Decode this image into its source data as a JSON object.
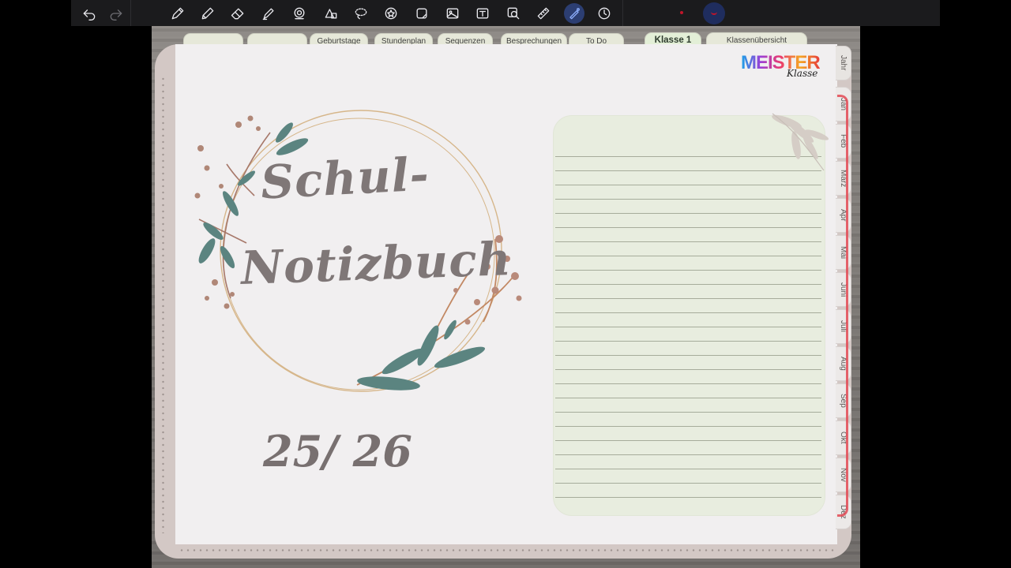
{
  "toolbar": {
    "tools": [
      {
        "name": "undo-icon",
        "label": "Undo"
      },
      {
        "name": "redo-icon",
        "label": "Redo"
      },
      {
        "name": "pen-icon",
        "label": "Pen"
      },
      {
        "name": "pencil-icon",
        "label": "Pencil"
      },
      {
        "name": "eraser-icon",
        "label": "Eraser"
      },
      {
        "name": "highlighter-icon",
        "label": "Highlighter"
      },
      {
        "name": "shapes-icon",
        "label": "Shapes"
      },
      {
        "name": "elements-icon",
        "label": "Elements"
      },
      {
        "name": "lasso-icon",
        "label": "Lasso"
      },
      {
        "name": "star-icon",
        "label": "Favorites"
      },
      {
        "name": "sticker-icon",
        "label": "Stickers"
      },
      {
        "name": "image-icon",
        "label": "Image"
      },
      {
        "name": "text-icon",
        "label": "Text"
      },
      {
        "name": "zoom-icon",
        "label": "Zoom"
      },
      {
        "name": "ruler-icon",
        "label": "Ruler"
      },
      {
        "name": "laser-icon",
        "label": "Laser"
      },
      {
        "name": "clock-icon",
        "label": "Timer"
      }
    ],
    "colors": {
      "background": "#1b1b1d",
      "icon": "#e9e9ee",
      "active": "#2c3e72",
      "record": "#c0152a"
    }
  },
  "planner": {
    "top_tabs": [
      {
        "label": ""
      },
      {
        "label": ""
      },
      {
        "label": "Geburtstage"
      },
      {
        "label": "Stundenplan"
      },
      {
        "label": "Sequenzen"
      },
      {
        "label": "Besprechungen"
      },
      {
        "label": "To Do"
      },
      {
        "label": "Klasse 1",
        "selected": true
      },
      {
        "label": "Klassenübersicht"
      }
    ],
    "month_tabs": [
      "Jahr",
      "Jan",
      "Feb",
      "März",
      "Apr",
      "Mai",
      "Juni",
      "Juli",
      "Aug",
      "Sep",
      "Okt",
      "Nov",
      "Dez"
    ],
    "cover": {
      "title_line_1": "Schul-",
      "title_line_2": "Notizbuch",
      "year": "25/ 26"
    },
    "logo": {
      "main": "MEISTER",
      "sub": "Klasse"
    },
    "colors": {
      "page": "#f1eff0",
      "frame": "#d3c8c5",
      "notes_box": "#e8eddf",
      "title": "#7f7777",
      "annotation": "#e34a55"
    }
  }
}
